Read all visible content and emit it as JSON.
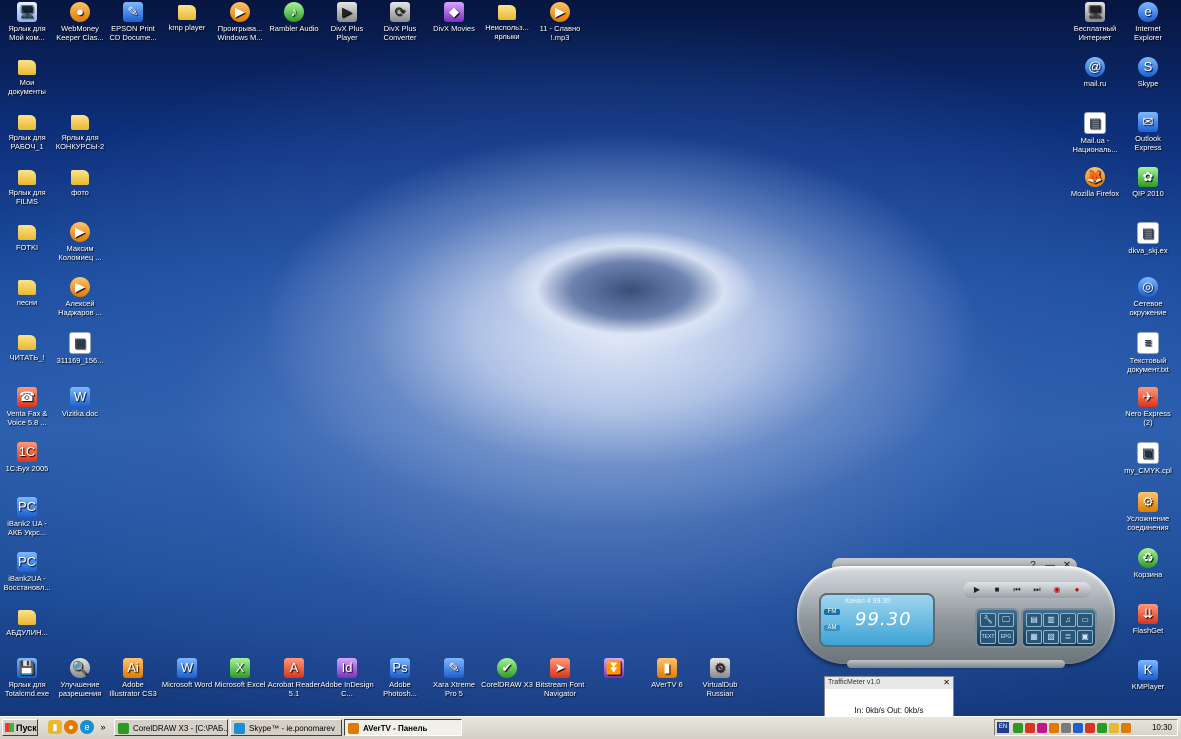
{
  "desktop": {
    "icons_top": [
      {
        "label": "Ярлык для Мой ком...",
        "glyph": "🖥",
        "cls": "app",
        "icon": "my-computer-icon"
      },
      {
        "label": "WebMoney Keeper Clas...",
        "glyph": "●",
        "cls": "orange round",
        "icon": "webmoney-icon"
      },
      {
        "label": "EPSON Print CD Docume...",
        "glyph": "✎",
        "cls": "blue",
        "icon": "epson-icon"
      },
      {
        "label": "kmp player",
        "glyph": "",
        "cls": "folder",
        "icon": "folder-icon"
      },
      {
        "label": "Проигрыва... Windows M...",
        "glyph": "▶",
        "cls": "orange round",
        "icon": "media-player-icon"
      },
      {
        "label": "Rambler Audio",
        "glyph": "♪",
        "cls": "green round",
        "icon": "rambler-audio-icon"
      },
      {
        "label": "DivX Plus Player",
        "glyph": "▶",
        "cls": "grey",
        "icon": "divx-player-icon"
      },
      {
        "label": "DivX Plus Converter",
        "glyph": "⟳",
        "cls": "grey",
        "icon": "divx-converter-icon"
      },
      {
        "label": "DivX Movies",
        "glyph": "◆",
        "cls": "purple",
        "icon": "divx-movies-icon"
      },
      {
        "label": "Неиспольз... ярлыки",
        "glyph": "",
        "cls": "folder",
        "icon": "folder-icon"
      },
      {
        "label": "11 - Славно !.mp3",
        "glyph": "▶",
        "cls": "orange round",
        "icon": "mp3-file-icon"
      }
    ],
    "icons_left": [
      {
        "label": "Мои документы",
        "glyph": "",
        "cls": "folder",
        "icon": "my-documents-icon",
        "col": 0,
        "row": 1
      },
      {
        "label": "Ярлык для РАБОЧ_1",
        "glyph": "",
        "cls": "folder",
        "icon": "folder-icon",
        "col": 0,
        "row": 2
      },
      {
        "label": "Ярлык для КОНКУРСЫ-2",
        "glyph": "",
        "cls": "folder",
        "icon": "folder-icon",
        "col": 1,
        "row": 2
      },
      {
        "label": "Ярлык для FILMS",
        "glyph": "",
        "cls": "folder",
        "icon": "folder-icon",
        "col": 0,
        "row": 3
      },
      {
        "label": "фото",
        "glyph": "",
        "cls": "folder",
        "icon": "folder-icon",
        "col": 1,
        "row": 3
      },
      {
        "label": "FOTKI",
        "glyph": "",
        "cls": "folder",
        "icon": "folder-icon",
        "col": 0,
        "row": 4
      },
      {
        "label": "Максим Коломиец ...",
        "glyph": "▶",
        "cls": "orange round",
        "icon": "media-file-icon",
        "col": 1,
        "row": 4
      },
      {
        "label": "песни",
        "glyph": "",
        "cls": "folder",
        "icon": "folder-icon",
        "col": 0,
        "row": 5
      },
      {
        "label": "Алексей Наджаров ...",
        "glyph": "▶",
        "cls": "orange round",
        "icon": "media-file-icon",
        "col": 1,
        "row": 5
      },
      {
        "label": "ЧИТАТЬ_!",
        "glyph": "",
        "cls": "folder",
        "icon": "folder-icon",
        "col": 0,
        "row": 6
      },
      {
        "label": "311169_156...",
        "glyph": "▦",
        "cls": "doc",
        "icon": "image-file-icon",
        "col": 1,
        "row": 6
      },
      {
        "label": "Venta Fax & Voice 5.8 ...",
        "glyph": "☎",
        "cls": "red",
        "icon": "ventafax-icon",
        "col": 0,
        "row": 7
      },
      {
        "label": "Vizitka.doc",
        "glyph": "W",
        "cls": "blue",
        "icon": "word-doc-icon",
        "col": 1,
        "row": 7
      },
      {
        "label": "1С:Бух 2005",
        "glyph": "1С",
        "cls": "red",
        "icon": "1c-icon",
        "col": 0,
        "row": 8
      },
      {
        "label": "iBank2 UA - АКБ Укрс...",
        "glyph": "PC",
        "cls": "blue",
        "icon": "ibank-icon",
        "col": 0,
        "row": 9
      },
      {
        "label": "iBank2UA - Восстановл...",
        "glyph": "PC",
        "cls": "blue",
        "icon": "ibank-icon",
        "col": 0,
        "row": 10
      },
      {
        "label": "АБДУЛИН...",
        "glyph": "",
        "cls": "folder",
        "icon": "folder-icon",
        "col": 0,
        "row": 11
      }
    ],
    "icons_bottom": [
      {
        "label": "Ярлык для Totalcmd.exe",
        "glyph": "💾",
        "cls": "blue",
        "icon": "total-commander-icon"
      },
      {
        "label": "Улучшение разрешения",
        "glyph": "🔍",
        "cls": "grey round",
        "icon": "magnifier-icon"
      },
      {
        "label": "Adobe Illustrator CS3",
        "glyph": "Ai",
        "cls": "orange",
        "icon": "illustrator-icon"
      },
      {
        "label": "Microsoft Word",
        "glyph": "W",
        "cls": "blue",
        "icon": "ms-word-icon"
      },
      {
        "label": "Microsoft Excel",
        "glyph": "X",
        "cls": "green",
        "icon": "ms-excel-icon"
      },
      {
        "label": "Acrobat Reader 5.1",
        "glyph": "A",
        "cls": "red",
        "icon": "acrobat-icon"
      },
      {
        "label": "Adobe InDesign C...",
        "glyph": "Id",
        "cls": "purple",
        "icon": "indesign-icon"
      },
      {
        "label": "Adobe Photosh...",
        "glyph": "Ps",
        "cls": "blue",
        "icon": "photoshop-icon"
      },
      {
        "label": "Xara Xtreme Pro 5",
        "glyph": "✎",
        "cls": "blue",
        "icon": "xara-icon"
      },
      {
        "label": "CorelDRAW X3",
        "glyph": "✔",
        "cls": "green round",
        "icon": "coreldraw-icon"
      },
      {
        "label": "Bitstream Font Navigator",
        "glyph": "➤",
        "cls": "red",
        "icon": "font-navigator-icon"
      },
      {
        "label": "",
        "glyph": "⏬",
        "cls": "purple",
        "icon": "download-icon"
      },
      {
        "label": "AVerTV 6",
        "glyph": "▮",
        "cls": "orange",
        "icon": "avertv-icon"
      },
      {
        "label": "VirtualDub Russian",
        "glyph": "⚙",
        "cls": "grey",
        "icon": "virtualdub-icon"
      }
    ],
    "icons_right": [
      {
        "label": "Бесплатный Интернет",
        "glyph": "🖥",
        "cls": "grey",
        "icon": "free-internet-icon",
        "col": 0,
        "row": 0
      },
      {
        "label": "Internet Explorer",
        "glyph": "e",
        "cls": "blue round",
        "icon": "internet-explorer-icon",
        "col": 1,
        "row": 0
      },
      {
        "label": "mail.ru",
        "glyph": "@",
        "cls": "blue round",
        "icon": "mailru-icon",
        "col": 0,
        "row": 1
      },
      {
        "label": "Skype",
        "glyph": "S",
        "cls": "blue round",
        "icon": "skype-icon",
        "col": 1,
        "row": 1
      },
      {
        "label": "Mail.ua - Националь...",
        "glyph": "▤",
        "cls": "doc",
        "icon": "mailua-icon",
        "col": 0,
        "row": 2
      },
      {
        "label": "Outlook Express",
        "glyph": "✉",
        "cls": "blue",
        "icon": "outlook-express-icon",
        "col": 1,
        "row": 2
      },
      {
        "label": "Mozilla Firefox",
        "glyph": "🦊",
        "cls": "orange round",
        "icon": "firefox-icon",
        "col": 0,
        "row": 3
      },
      {
        "label": "QIP 2010",
        "glyph": "✿",
        "cls": "green",
        "icon": "qip-icon",
        "col": 1,
        "row": 3
      },
      {
        "label": "dkva_skj.ex",
        "glyph": "▤",
        "cls": "doc",
        "icon": "file-icon",
        "col": 1,
        "row": 4
      },
      {
        "label": "Сетевое окружение",
        "glyph": "◎",
        "cls": "blue round",
        "icon": "network-icon",
        "col": 1,
        "row": 5
      },
      {
        "label": "Текстовый документ.txt",
        "glyph": "≡",
        "cls": "doc",
        "icon": "text-file-icon",
        "col": 1,
        "row": 6
      },
      {
        "label": "Nero Express (2)",
        "glyph": "✈",
        "cls": "red",
        "icon": "nero-icon",
        "col": 1,
        "row": 7
      },
      {
        "label": "my_CMYK.cpl",
        "glyph": "▣",
        "cls": "doc",
        "icon": "cpl-file-icon",
        "col": 1,
        "row": 8
      },
      {
        "label": "Усложнение соединения",
        "glyph": "⚙",
        "cls": "orange",
        "icon": "connection-icon",
        "col": 1,
        "row": 9
      },
      {
        "label": "Корзина",
        "glyph": "♻",
        "cls": "green round",
        "icon": "recycle-bin-icon",
        "col": 1,
        "row": 10
      },
      {
        "label": "FlashGet",
        "glyph": "⇊",
        "cls": "red",
        "icon": "flashget-icon",
        "col": 1,
        "row": 11
      },
      {
        "label": "KMPlayer",
        "glyph": "K",
        "cls": "blue",
        "icon": "kmplayer-icon",
        "col": 1,
        "row": 12
      }
    ]
  },
  "avertv": {
    "help": "?",
    "minimize": "—",
    "close": "✕",
    "channel": "Канал 4 99.30",
    "frequency": "99.30",
    "band_fm": "FM",
    "band_am": "AM",
    "transport": [
      "▶",
      "■",
      "⏮",
      "⏭",
      "◉",
      "●"
    ],
    "pad_left": [
      "🔧",
      "🖵",
      "TEXT",
      "EPG"
    ],
    "pad_right": [
      "▤",
      "▥",
      "♫",
      "▭",
      "▦",
      "▧",
      "≣",
      "▣"
    ]
  },
  "trafficmeter": {
    "title": "TrafficMeter v1.0",
    "close": "✕",
    "stats": "In: 0kb/s  Out: 0kb/s"
  },
  "taskbar": {
    "start_label": "Пуск",
    "overflow": "»",
    "tasks": [
      {
        "label": "CorelDRAW X3 - [C:\\РАБ...",
        "active": false,
        "color": "#2d9b23",
        "icon": "coreldraw-task-icon"
      },
      {
        "label": "Skype™ - ie.ponomarev",
        "active": false,
        "color": "#1b8fd1",
        "icon": "skype-task-icon"
      },
      {
        "label": "AVerTV - Панель",
        "active": true,
        "color": "#e07a00",
        "icon": "avertv-task-icon"
      }
    ],
    "tray_lang": "EN",
    "clock": "10:30"
  }
}
